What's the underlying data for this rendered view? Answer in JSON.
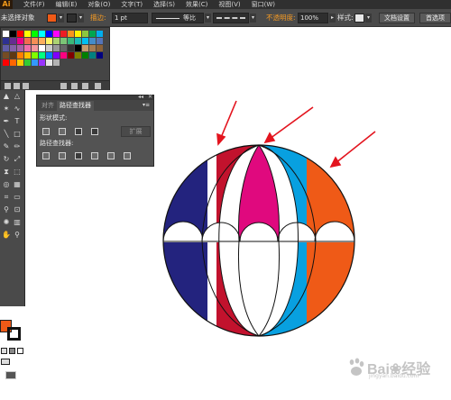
{
  "app": {
    "logo": "Ai"
  },
  "menu": [
    "文件(F)",
    "编辑(E)",
    "对象(O)",
    "文字(T)",
    "选择(S)",
    "效果(C)",
    "视图(V)",
    "窗口(W)"
  ],
  "control_bar": {
    "selection_label": "未选择对象",
    "stroke_label": "描边:",
    "stroke_weight": "1 pt",
    "stroke_style": "等比",
    "opacity_label": "不透明度:",
    "opacity_value": "100%",
    "style_label": "样式:",
    "doc_settings_button": "文档设置",
    "preferences_button": "首选项",
    "fill_color": "#ef5a17"
  },
  "swatches": {
    "colors": [
      "#ffffff",
      "#000000",
      "#ff0000",
      "#ffff00",
      "#00ff00",
      "#00ffff",
      "#0000ff",
      "#ff00ff",
      "#ed1c24",
      "#f7941d",
      "#fff200",
      "#8dc63f",
      "#00a651",
      "#00aeef",
      "#2e3192",
      "#662d91",
      "#ec008c",
      "#f26c4f",
      "#f68e56",
      "#fbaf5d",
      "#fff467",
      "#acd372",
      "#7cc576",
      "#3bb878",
      "#1abbb4",
      "#00bff3",
      "#438cca",
      "#5574b9",
      "#605ca8",
      "#855fa8",
      "#a763a8",
      "#f06eaa",
      "#f5989d",
      "#ffffff",
      "#cccccc",
      "#999999",
      "#666666",
      "#333333",
      "#000000",
      "#c69c6d",
      "#a67c52",
      "#8c6239",
      "#754c24",
      "#603913",
      "#ff7f00",
      "#ffbf00",
      "#80ff00",
      "#00ff80",
      "#0080ff",
      "#8000ff",
      "#ff0080",
      "#800000",
      "#808000",
      "#008000",
      "#008080",
      "#000080",
      "#ff0000",
      "#ff6600",
      "#ffcc00",
      "#33cc33",
      "#3399ff",
      "#9933ff",
      "#e6e6e6",
      "#b3b3b3"
    ]
  },
  "pathfinder_panel": {
    "tab_align": "对齐",
    "tab_pathfinder": "路径查找器",
    "shape_modes_label": "形状模式:",
    "pathfinders_label": "路径查找器:",
    "expand_button": "扩展",
    "menu_icon": "menu-icon",
    "close_icon": "close-icon"
  },
  "tools": {
    "fill_color": "#ef5a17",
    "stroke_color": "#111111"
  },
  "artwork": {
    "colors": {
      "navy": "#23237e",
      "crimson": "#c2122d",
      "magenta": "#e0097e",
      "sky": "#08a0e0",
      "orange": "#ef5a17",
      "arrow": "#e3141e"
    }
  },
  "watermark": {
    "text": "Bai❀经验",
    "sub": "jingyan.baidu.com"
  }
}
